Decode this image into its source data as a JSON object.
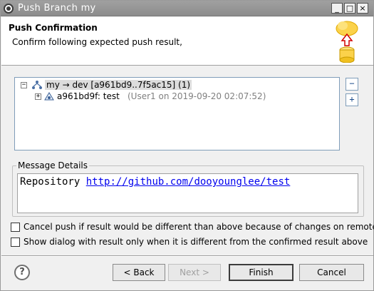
{
  "window": {
    "title": "Push Branch my"
  },
  "header": {
    "title": "Push Confirmation",
    "description": "Confirm following expected push result,"
  },
  "tree": {
    "root": {
      "label": "my → dev [a961bd9..7f5ac15] (1)",
      "expanded": true
    },
    "children": [
      {
        "commit_label": "a961bd9f: test",
        "meta": "(User1 on 2019-09-20 02:07:52)",
        "expanded": false
      }
    ],
    "collapse_all_symbol": "−",
    "expand_all_symbol": "+"
  },
  "message": {
    "group_label": "Message Details",
    "prefix": "Repository",
    "link": "http://github.com/dooyounglee/test"
  },
  "options": {
    "cancel_push_label": "Cancel push if result would be different than above because of changes on remote",
    "cancel_push_checked": false,
    "show_dialog_label": "Show dialog with result only when it is different from the confirmed result above",
    "show_dialog_checked": false
  },
  "buttons": {
    "back": "< Back",
    "next": "Next >",
    "finish": "Finish",
    "cancel": "Cancel",
    "help": "?"
  },
  "title_buttons": {
    "minimize": "_",
    "maximize": "□",
    "close": "×"
  }
}
